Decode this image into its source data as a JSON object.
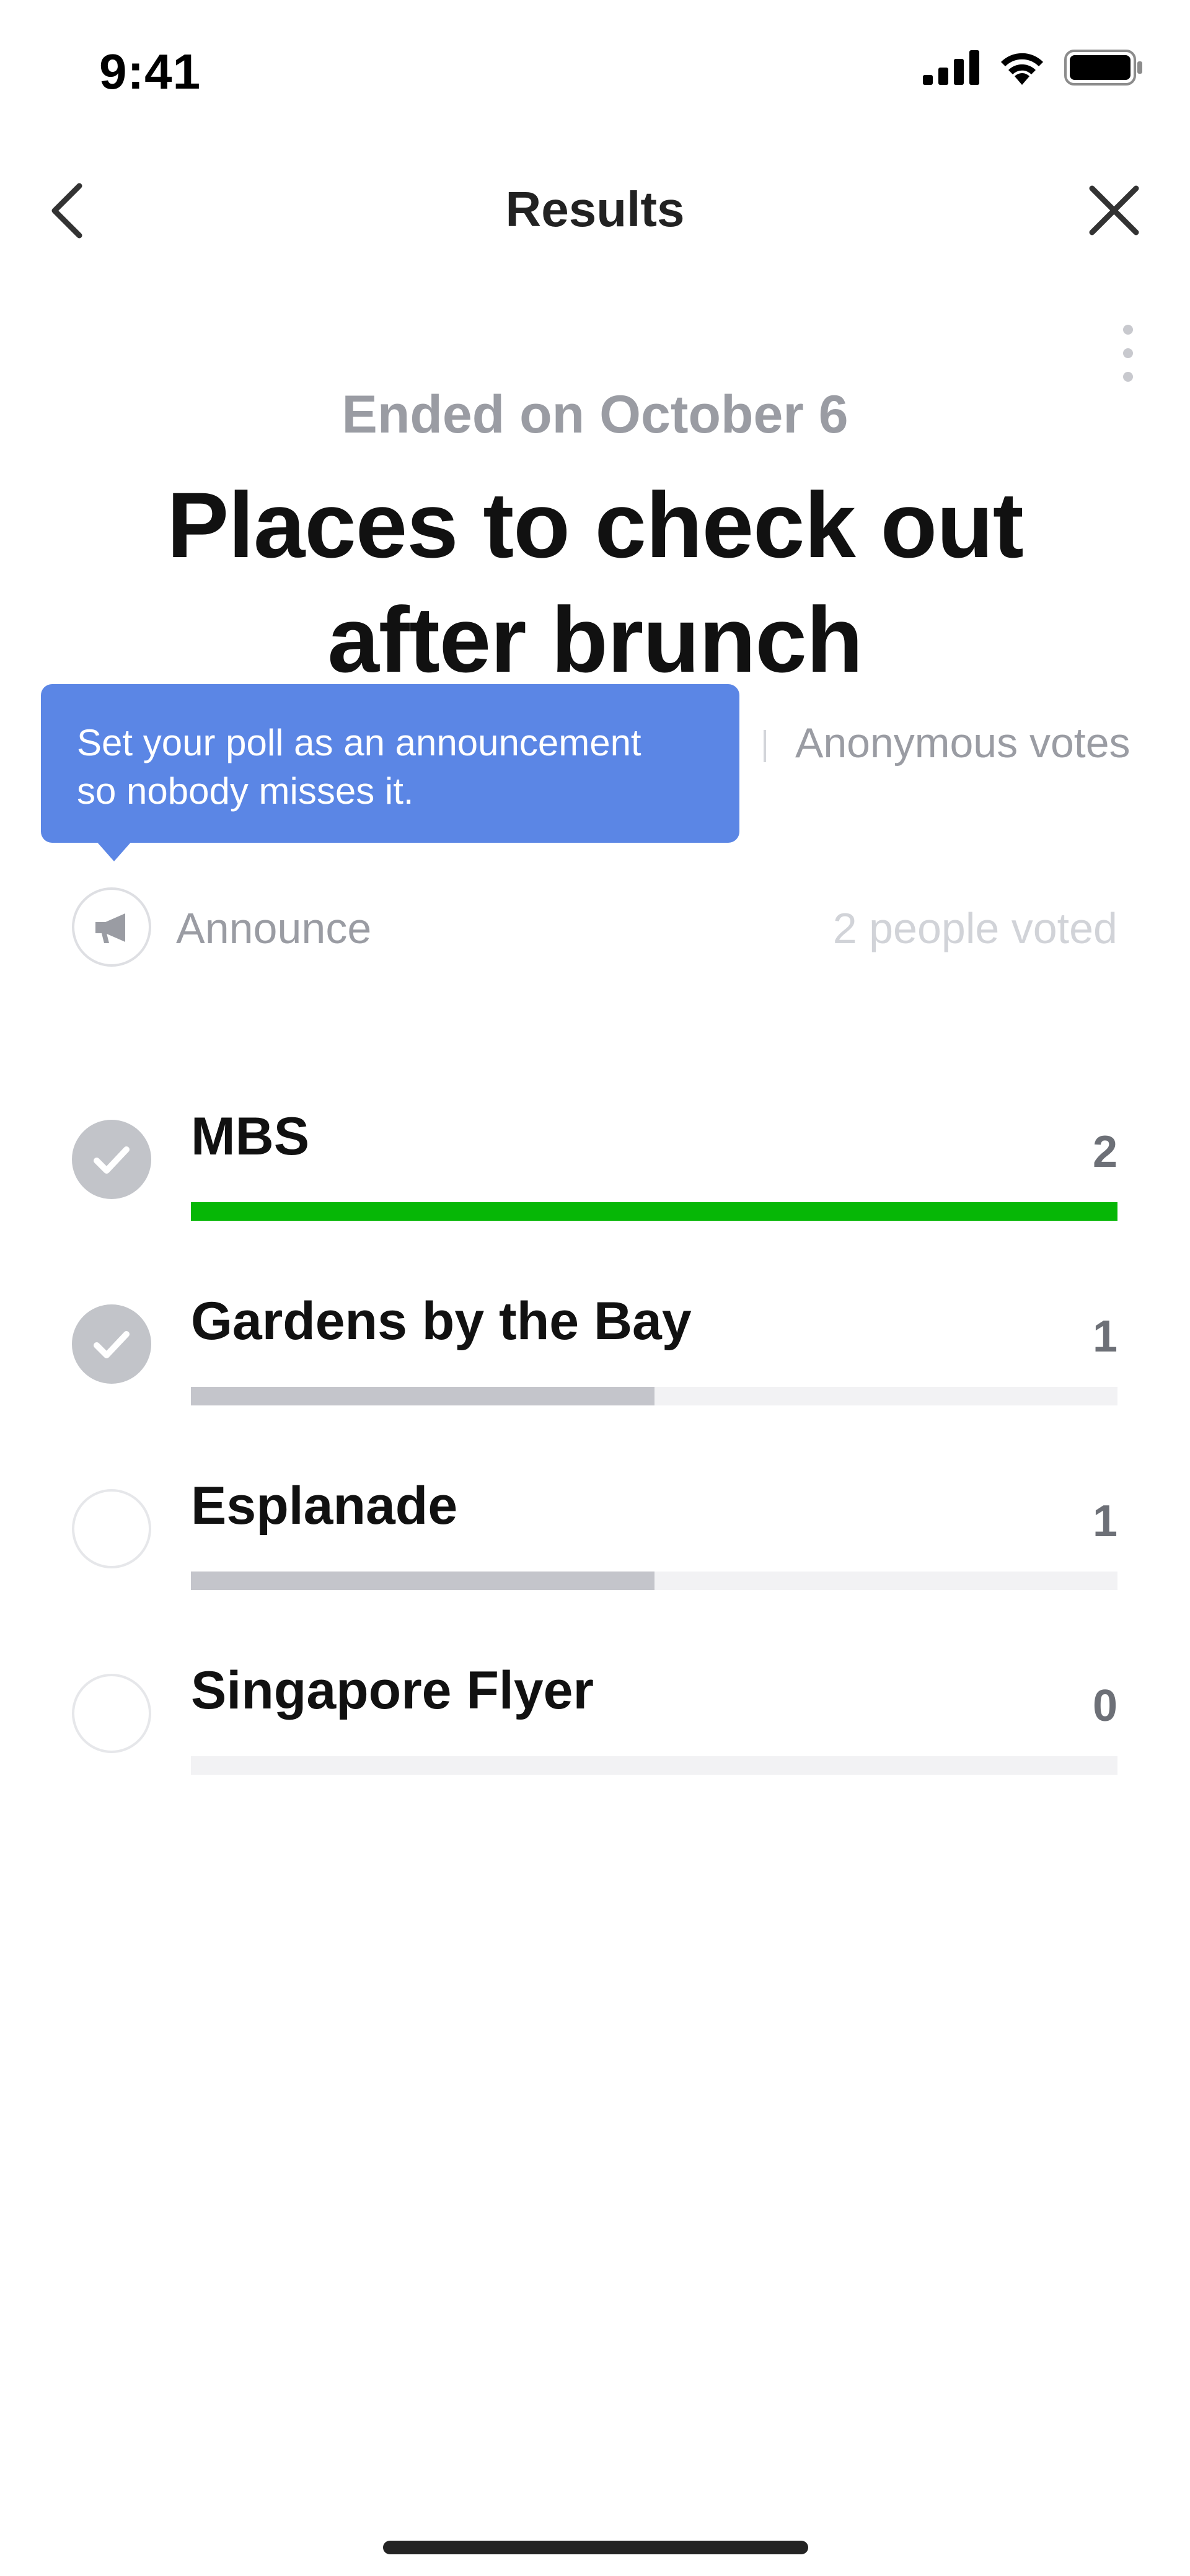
{
  "status_bar": {
    "time": "9:41",
    "icons": [
      "signal-icon",
      "wifi-icon",
      "battery-icon"
    ]
  },
  "nav": {
    "title": "Results",
    "back_icon": "chevron-left-icon",
    "close_icon": "close-icon",
    "more_icon": "more-vertical-icon"
  },
  "poll": {
    "ended_label": "Ended on October 6",
    "title": "Places to check out after brunch",
    "anonymous_label": "Anonymous votes",
    "tooltip": "Set your poll as an announcement\nso nobody misses it.",
    "announce_label": "Announce",
    "announce_icon": "megaphone-icon",
    "voters_label": "2 people voted",
    "options": [
      {
        "label": "MBS",
        "count": "2",
        "checked": true,
        "fraction": 1.0
      },
      {
        "label": "Gardens by the Bay",
        "count": "1",
        "checked": true,
        "fraction": 0.5
      },
      {
        "label": "Esplanade",
        "count": "1",
        "checked": false,
        "fraction": 0.5
      },
      {
        "label": "Singapore Flyer",
        "count": "0",
        "checked": false,
        "fraction": 0.0
      }
    ]
  },
  "colors": {
    "leader_bar": "#06b706",
    "other_bar": "#c4c5cb",
    "track": "#f2f2f4",
    "tooltip": "#5b86e5"
  }
}
